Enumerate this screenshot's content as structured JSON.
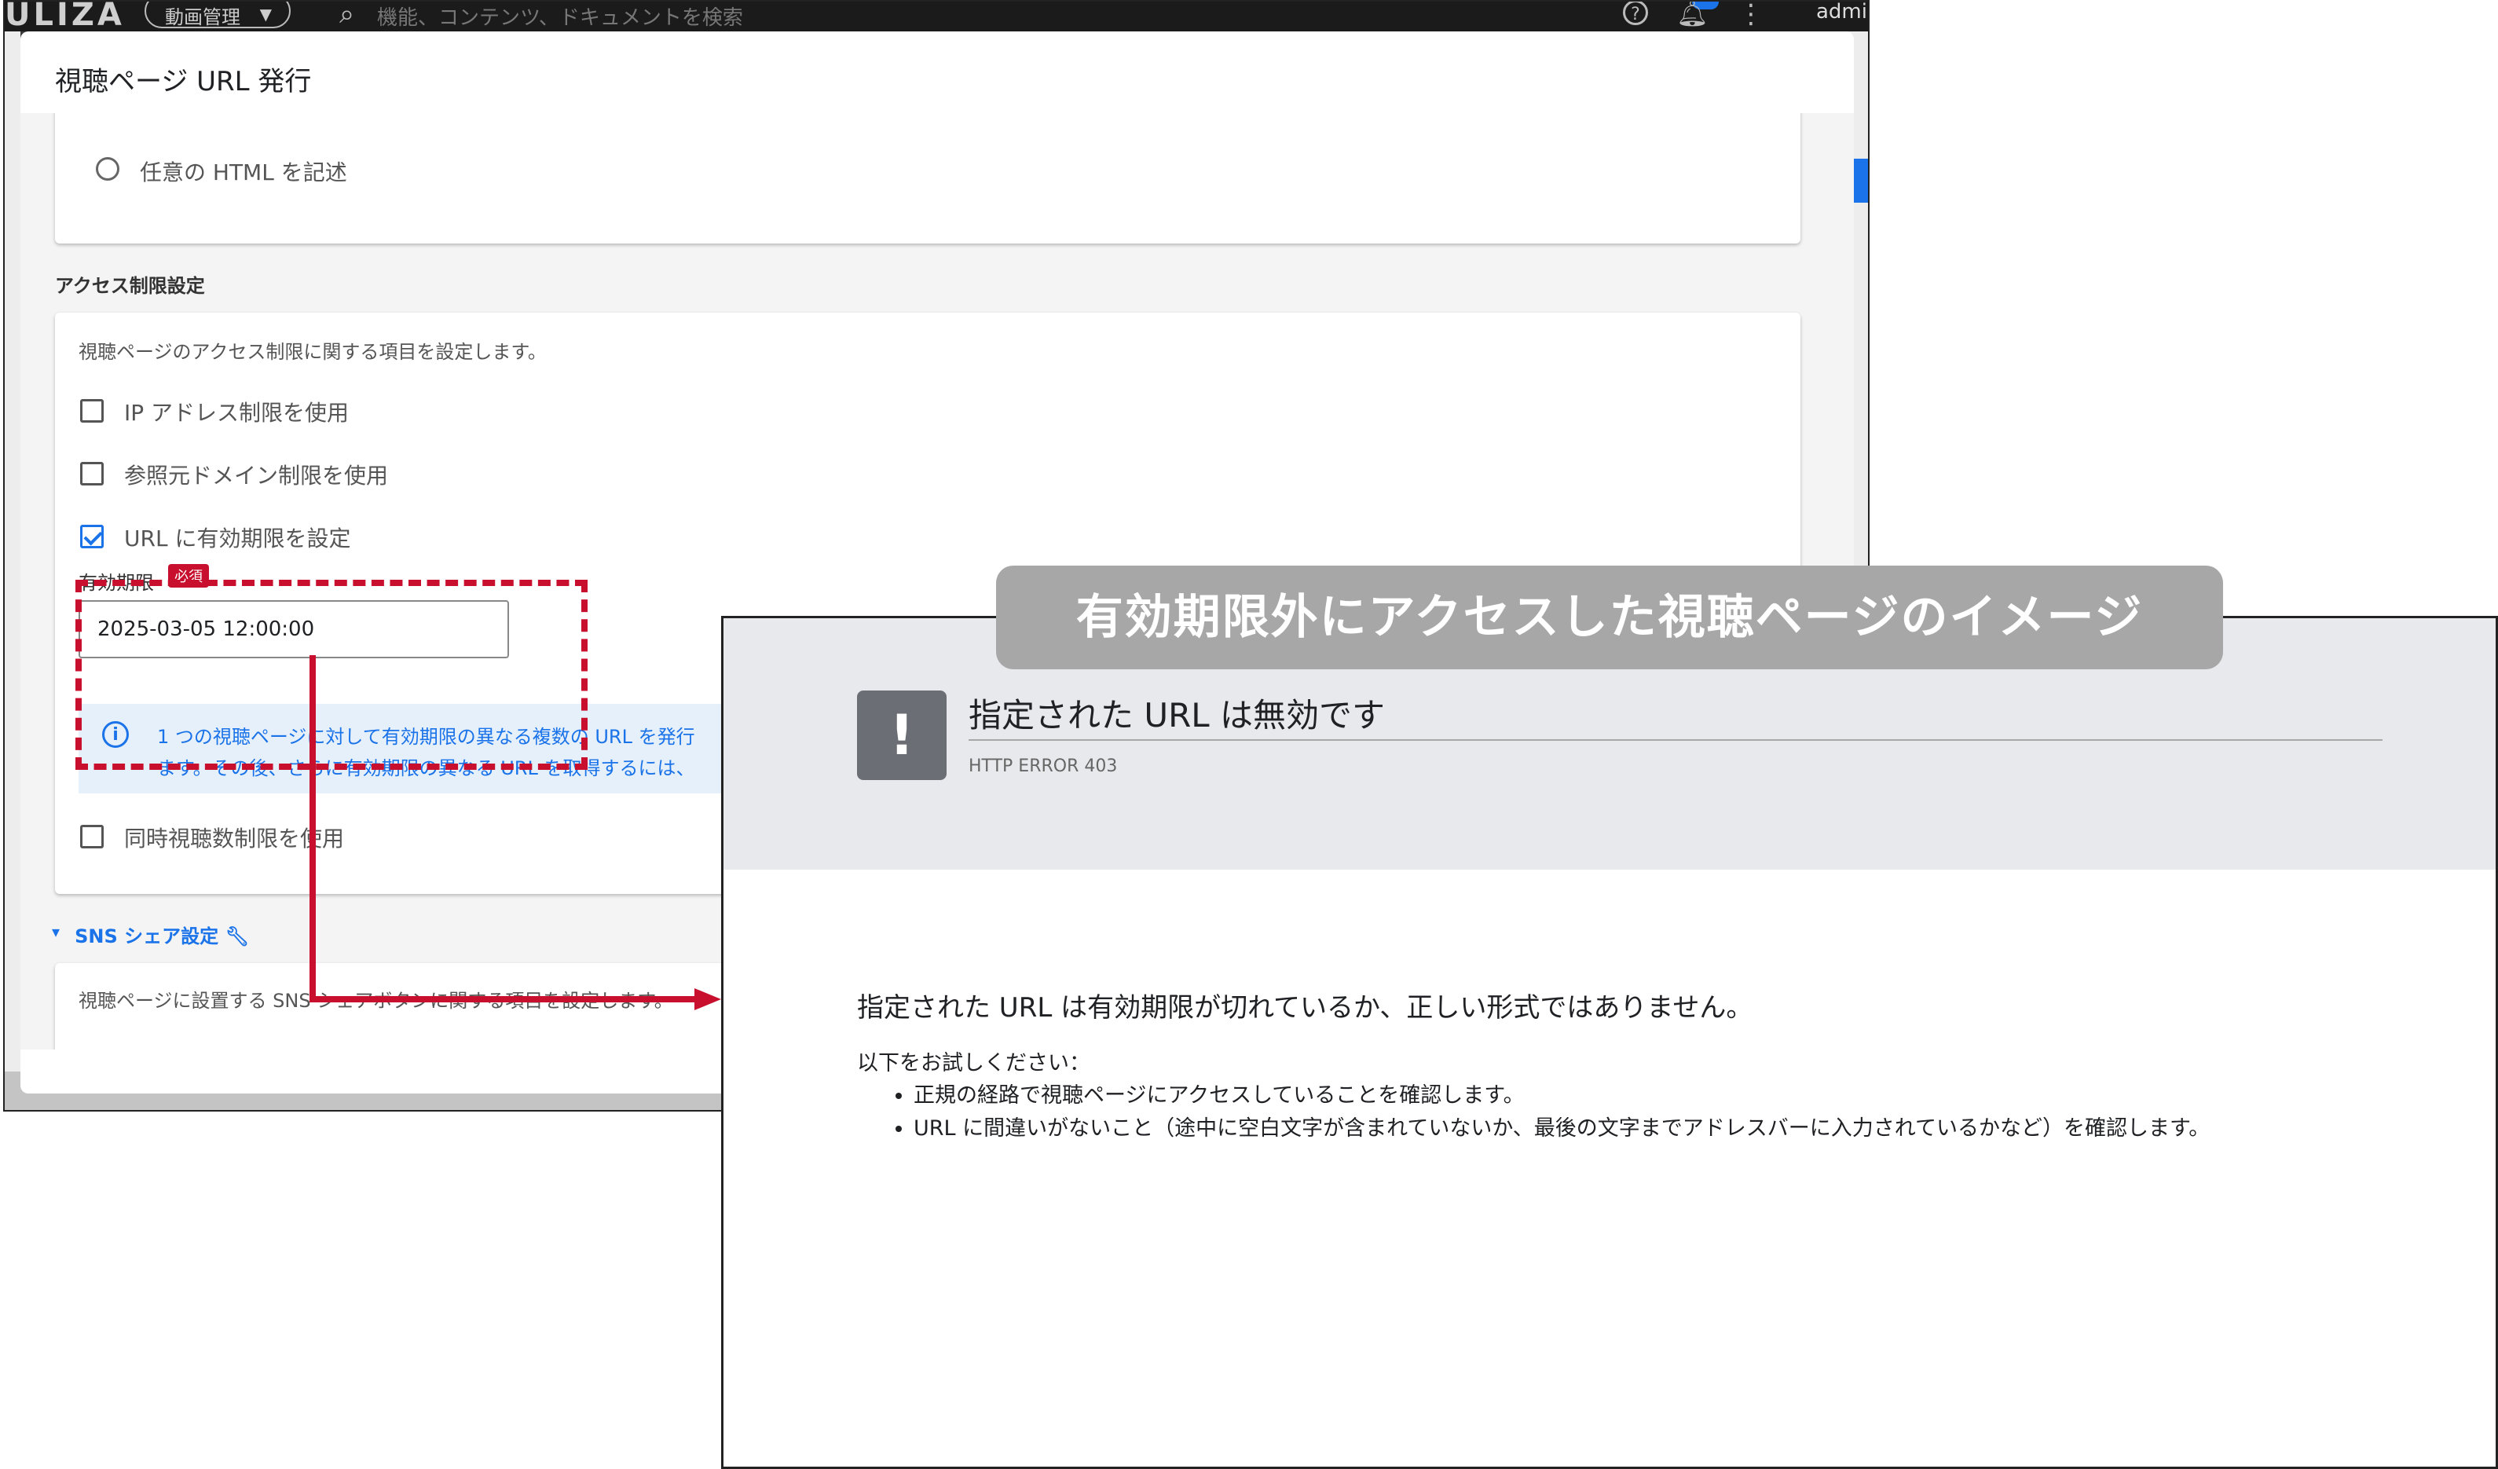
{
  "topbar": {
    "logo": "ULIZA",
    "menu_label": "動画管理",
    "search_placeholder": "機能、コンテンツ、ドキュメントを検索",
    "user_label": "admin"
  },
  "dialog": {
    "title": "視聴ページ URL 発行",
    "option_custom_html": "任意の HTML を記述",
    "access": {
      "section_title": "アクセス制限設定",
      "description": "視聴ページのアクセス制限に関する項目を設定します。",
      "ip_restriction": "IP アドレス制限を使用",
      "referer_restriction": "参照元ドメイン制限を使用",
      "url_expiry": "URL に有効期限を設定",
      "expiry_label": "有効期限",
      "required_badge": "必須",
      "expiry_value": "2025-03-05 12:00:00",
      "info_line1": "1 つの視聴ページに対して有効期限の異なる複数の URL を発行",
      "info_line2": "ます。その後、さらに有効期限の異なる URL を取得するには、",
      "concurrent_restriction": "同時視聴数制限を使用",
      "url_expiry_checked": true
    },
    "sns": {
      "heading": "SNS シェア設定",
      "description": "視聴ページに設置する SNS シェアボタンに関する項目を設定します。"
    }
  },
  "callout": {
    "text": "有効期限外にアクセスした視聴ページのイメージ"
  },
  "error_page": {
    "title": "指定された URL は無効です",
    "code": "HTTP ERROR 403",
    "message": "指定された URL は有効期限が切れているか、正しい形式ではありません。",
    "try_label": "以下をお試しください：",
    "suggestions": [
      "正規の経路で視聴ページにアクセスしていることを確認します。",
      "URL に間違いがないこと（途中に空白文字が含まれていないか、最後の文字までアドレスバーに入力されているかなど）を確認します。"
    ]
  },
  "colors": {
    "accent": "#1a73e8",
    "highlight": "#c8102e",
    "callout_bg": "#a7a7a7",
    "error_header_bg": "#e8e9ec"
  }
}
